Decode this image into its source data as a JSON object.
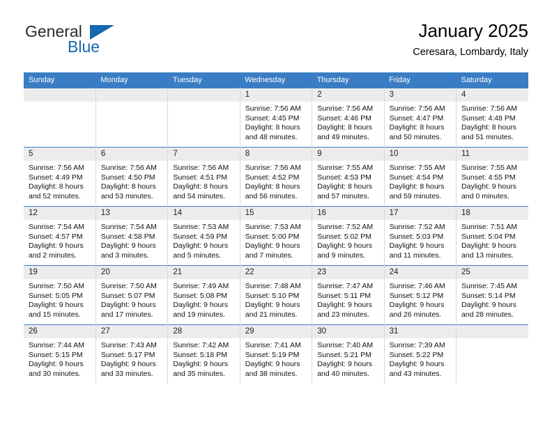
{
  "brand": {
    "name_part1": "General",
    "name_part2": "Blue",
    "triangle_icon": "triangle-icon",
    "accent_color": "#1468b0"
  },
  "header": {
    "title": "January 2025",
    "subtitle": "Ceresara, Lombardy, Italy"
  },
  "theme": {
    "header_row_bg": "#3b7dc4",
    "daynum_bg": "#ececec",
    "cell_border": "#d8d8d8",
    "text": "#111111"
  },
  "weekday_headers": [
    "Sunday",
    "Monday",
    "Tuesday",
    "Wednesday",
    "Thursday",
    "Friday",
    "Saturday"
  ],
  "labels": {
    "sunrise_prefix": "Sunrise:",
    "sunset_prefix": "Sunset:",
    "daylight_prefix": "Daylight:"
  },
  "weeks": [
    [
      {
        "day": "",
        "line1": "",
        "line2": "",
        "line3": "",
        "line4": "",
        "empty": true
      },
      {
        "day": "",
        "line1": "",
        "line2": "",
        "line3": "",
        "line4": "",
        "empty": true
      },
      {
        "day": "",
        "line1": "",
        "line2": "",
        "line3": "",
        "line4": "",
        "empty": true
      },
      {
        "day": "1",
        "line1": "Sunrise: 7:56 AM",
        "line2": "Sunset: 4:45 PM",
        "line3": "Daylight: 8 hours",
        "line4": "and 48 minutes.",
        "empty": false
      },
      {
        "day": "2",
        "line1": "Sunrise: 7:56 AM",
        "line2": "Sunset: 4:46 PM",
        "line3": "Daylight: 8 hours",
        "line4": "and 49 minutes.",
        "empty": false
      },
      {
        "day": "3",
        "line1": "Sunrise: 7:56 AM",
        "line2": "Sunset: 4:47 PM",
        "line3": "Daylight: 8 hours",
        "line4": "and 50 minutes.",
        "empty": false
      },
      {
        "day": "4",
        "line1": "Sunrise: 7:56 AM",
        "line2": "Sunset: 4:48 PM",
        "line3": "Daylight: 8 hours",
        "line4": "and 51 minutes.",
        "empty": false
      }
    ],
    [
      {
        "day": "5",
        "line1": "Sunrise: 7:56 AM",
        "line2": "Sunset: 4:49 PM",
        "line3": "Daylight: 8 hours",
        "line4": "and 52 minutes.",
        "empty": false
      },
      {
        "day": "6",
        "line1": "Sunrise: 7:56 AM",
        "line2": "Sunset: 4:50 PM",
        "line3": "Daylight: 8 hours",
        "line4": "and 53 minutes.",
        "empty": false
      },
      {
        "day": "7",
        "line1": "Sunrise: 7:56 AM",
        "line2": "Sunset: 4:51 PM",
        "line3": "Daylight: 8 hours",
        "line4": "and 54 minutes.",
        "empty": false
      },
      {
        "day": "8",
        "line1": "Sunrise: 7:56 AM",
        "line2": "Sunset: 4:52 PM",
        "line3": "Daylight: 8 hours",
        "line4": "and 56 minutes.",
        "empty": false
      },
      {
        "day": "9",
        "line1": "Sunrise: 7:55 AM",
        "line2": "Sunset: 4:53 PM",
        "line3": "Daylight: 8 hours",
        "line4": "and 57 minutes.",
        "empty": false
      },
      {
        "day": "10",
        "line1": "Sunrise: 7:55 AM",
        "line2": "Sunset: 4:54 PM",
        "line3": "Daylight: 8 hours",
        "line4": "and 59 minutes.",
        "empty": false
      },
      {
        "day": "11",
        "line1": "Sunrise: 7:55 AM",
        "line2": "Sunset: 4:55 PM",
        "line3": "Daylight: 9 hours",
        "line4": "and 0 minutes.",
        "empty": false
      }
    ],
    [
      {
        "day": "12",
        "line1": "Sunrise: 7:54 AM",
        "line2": "Sunset: 4:57 PM",
        "line3": "Daylight: 9 hours",
        "line4": "and 2 minutes.",
        "empty": false
      },
      {
        "day": "13",
        "line1": "Sunrise: 7:54 AM",
        "line2": "Sunset: 4:58 PM",
        "line3": "Daylight: 9 hours",
        "line4": "and 3 minutes.",
        "empty": false
      },
      {
        "day": "14",
        "line1": "Sunrise: 7:53 AM",
        "line2": "Sunset: 4:59 PM",
        "line3": "Daylight: 9 hours",
        "line4": "and 5 minutes.",
        "empty": false
      },
      {
        "day": "15",
        "line1": "Sunrise: 7:53 AM",
        "line2": "Sunset: 5:00 PM",
        "line3": "Daylight: 9 hours",
        "line4": "and 7 minutes.",
        "empty": false
      },
      {
        "day": "16",
        "line1": "Sunrise: 7:52 AM",
        "line2": "Sunset: 5:02 PM",
        "line3": "Daylight: 9 hours",
        "line4": "and 9 minutes.",
        "empty": false
      },
      {
        "day": "17",
        "line1": "Sunrise: 7:52 AM",
        "line2": "Sunset: 5:03 PM",
        "line3": "Daylight: 9 hours",
        "line4": "and 11 minutes.",
        "empty": false
      },
      {
        "day": "18",
        "line1": "Sunrise: 7:51 AM",
        "line2": "Sunset: 5:04 PM",
        "line3": "Daylight: 9 hours",
        "line4": "and 13 minutes.",
        "empty": false
      }
    ],
    [
      {
        "day": "19",
        "line1": "Sunrise: 7:50 AM",
        "line2": "Sunset: 5:05 PM",
        "line3": "Daylight: 9 hours",
        "line4": "and 15 minutes.",
        "empty": false
      },
      {
        "day": "20",
        "line1": "Sunrise: 7:50 AM",
        "line2": "Sunset: 5:07 PM",
        "line3": "Daylight: 9 hours",
        "line4": "and 17 minutes.",
        "empty": false
      },
      {
        "day": "21",
        "line1": "Sunrise: 7:49 AM",
        "line2": "Sunset: 5:08 PM",
        "line3": "Daylight: 9 hours",
        "line4": "and 19 minutes.",
        "empty": false
      },
      {
        "day": "22",
        "line1": "Sunrise: 7:48 AM",
        "line2": "Sunset: 5:10 PM",
        "line3": "Daylight: 9 hours",
        "line4": "and 21 minutes.",
        "empty": false
      },
      {
        "day": "23",
        "line1": "Sunrise: 7:47 AM",
        "line2": "Sunset: 5:11 PM",
        "line3": "Daylight: 9 hours",
        "line4": "and 23 minutes.",
        "empty": false
      },
      {
        "day": "24",
        "line1": "Sunrise: 7:46 AM",
        "line2": "Sunset: 5:12 PM",
        "line3": "Daylight: 9 hours",
        "line4": "and 26 minutes.",
        "empty": false
      },
      {
        "day": "25",
        "line1": "Sunrise: 7:45 AM",
        "line2": "Sunset: 5:14 PM",
        "line3": "Daylight: 9 hours",
        "line4": "and 28 minutes.",
        "empty": false
      }
    ],
    [
      {
        "day": "26",
        "line1": "Sunrise: 7:44 AM",
        "line2": "Sunset: 5:15 PM",
        "line3": "Daylight: 9 hours",
        "line4": "and 30 minutes.",
        "empty": false
      },
      {
        "day": "27",
        "line1": "Sunrise: 7:43 AM",
        "line2": "Sunset: 5:17 PM",
        "line3": "Daylight: 9 hours",
        "line4": "and 33 minutes.",
        "empty": false
      },
      {
        "day": "28",
        "line1": "Sunrise: 7:42 AM",
        "line2": "Sunset: 5:18 PM",
        "line3": "Daylight: 9 hours",
        "line4": "and 35 minutes.",
        "empty": false
      },
      {
        "day": "29",
        "line1": "Sunrise: 7:41 AM",
        "line2": "Sunset: 5:19 PM",
        "line3": "Daylight: 9 hours",
        "line4": "and 38 minutes.",
        "empty": false
      },
      {
        "day": "30",
        "line1": "Sunrise: 7:40 AM",
        "line2": "Sunset: 5:21 PM",
        "line3": "Daylight: 9 hours",
        "line4": "and 40 minutes.",
        "empty": false
      },
      {
        "day": "31",
        "line1": "Sunrise: 7:39 AM",
        "line2": "Sunset: 5:22 PM",
        "line3": "Daylight: 9 hours",
        "line4": "and 43 minutes.",
        "empty": false
      },
      {
        "day": "",
        "line1": "",
        "line2": "",
        "line3": "",
        "line4": "",
        "empty": true
      }
    ]
  ]
}
